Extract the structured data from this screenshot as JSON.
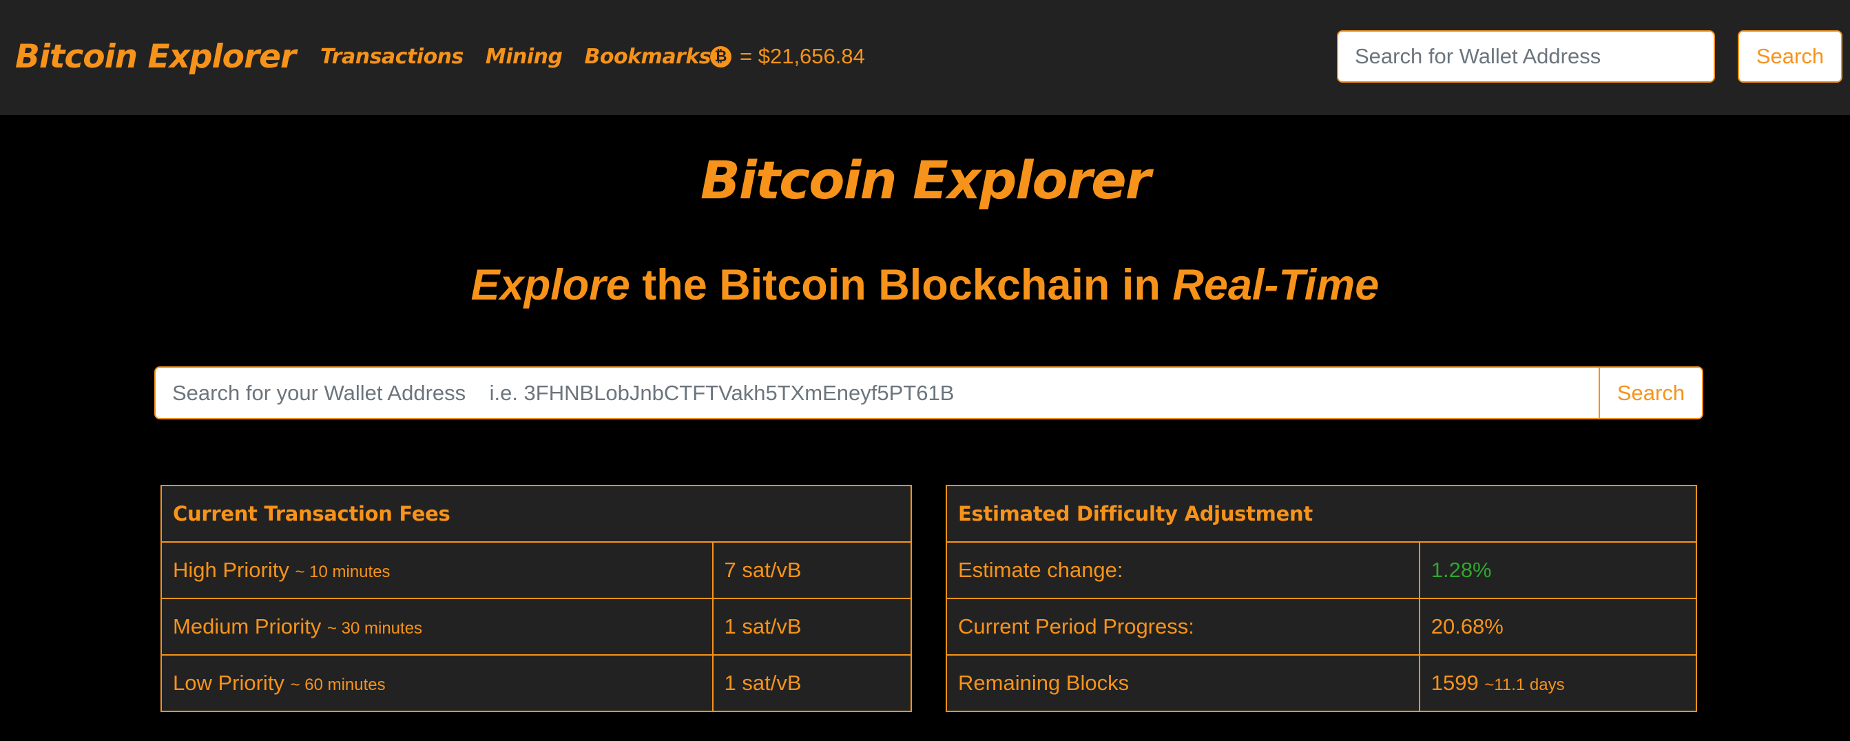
{
  "nav": {
    "brand": "Bitcoin Explorer",
    "links": [
      "Transactions",
      "Mining",
      "Bookmarks"
    ],
    "price_text": "= $21,656.84",
    "btc_icon": "bitcoin-coin-icon",
    "search_placeholder": "Search for Wallet Address",
    "search_button": "Search"
  },
  "hero": {
    "logo": "Bitcoin Explorer",
    "tagline_em1": "Explore",
    "tagline_mid": " the Bitcoin Blockchain in ",
    "tagline_em2": "Real-Time"
  },
  "main_search": {
    "placeholder": "Search for your Wallet Address    i.e. 3FHNBLobJnbCTFTVakh5TXmEneyf5PT61B",
    "button": "Search"
  },
  "fees": {
    "title": "Current Transaction Fees",
    "rows": [
      {
        "label": "High Priority",
        "note": "~ 10 minutes",
        "value": "7 sat/vB"
      },
      {
        "label": "Medium Priority",
        "note": "~ 30 minutes",
        "value": "1 sat/vB"
      },
      {
        "label": "Low Priority",
        "note": "~ 60 minutes",
        "value": "1 sat/vB"
      }
    ]
  },
  "difficulty": {
    "title": "Estimated Difficulty Adjustment",
    "rows": [
      {
        "label": "Estimate change:",
        "value": "1.28%",
        "note": ""
      },
      {
        "label": "Current Period Progress:",
        "value": "20.68%",
        "note": ""
      },
      {
        "label": "Remaining Blocks",
        "value": "1599",
        "note": "~11.1 days"
      }
    ]
  },
  "colors": {
    "accent": "#F7931A",
    "navbar_bg": "#222222",
    "page_bg": "#000000",
    "positive": "#2fa52f"
  }
}
